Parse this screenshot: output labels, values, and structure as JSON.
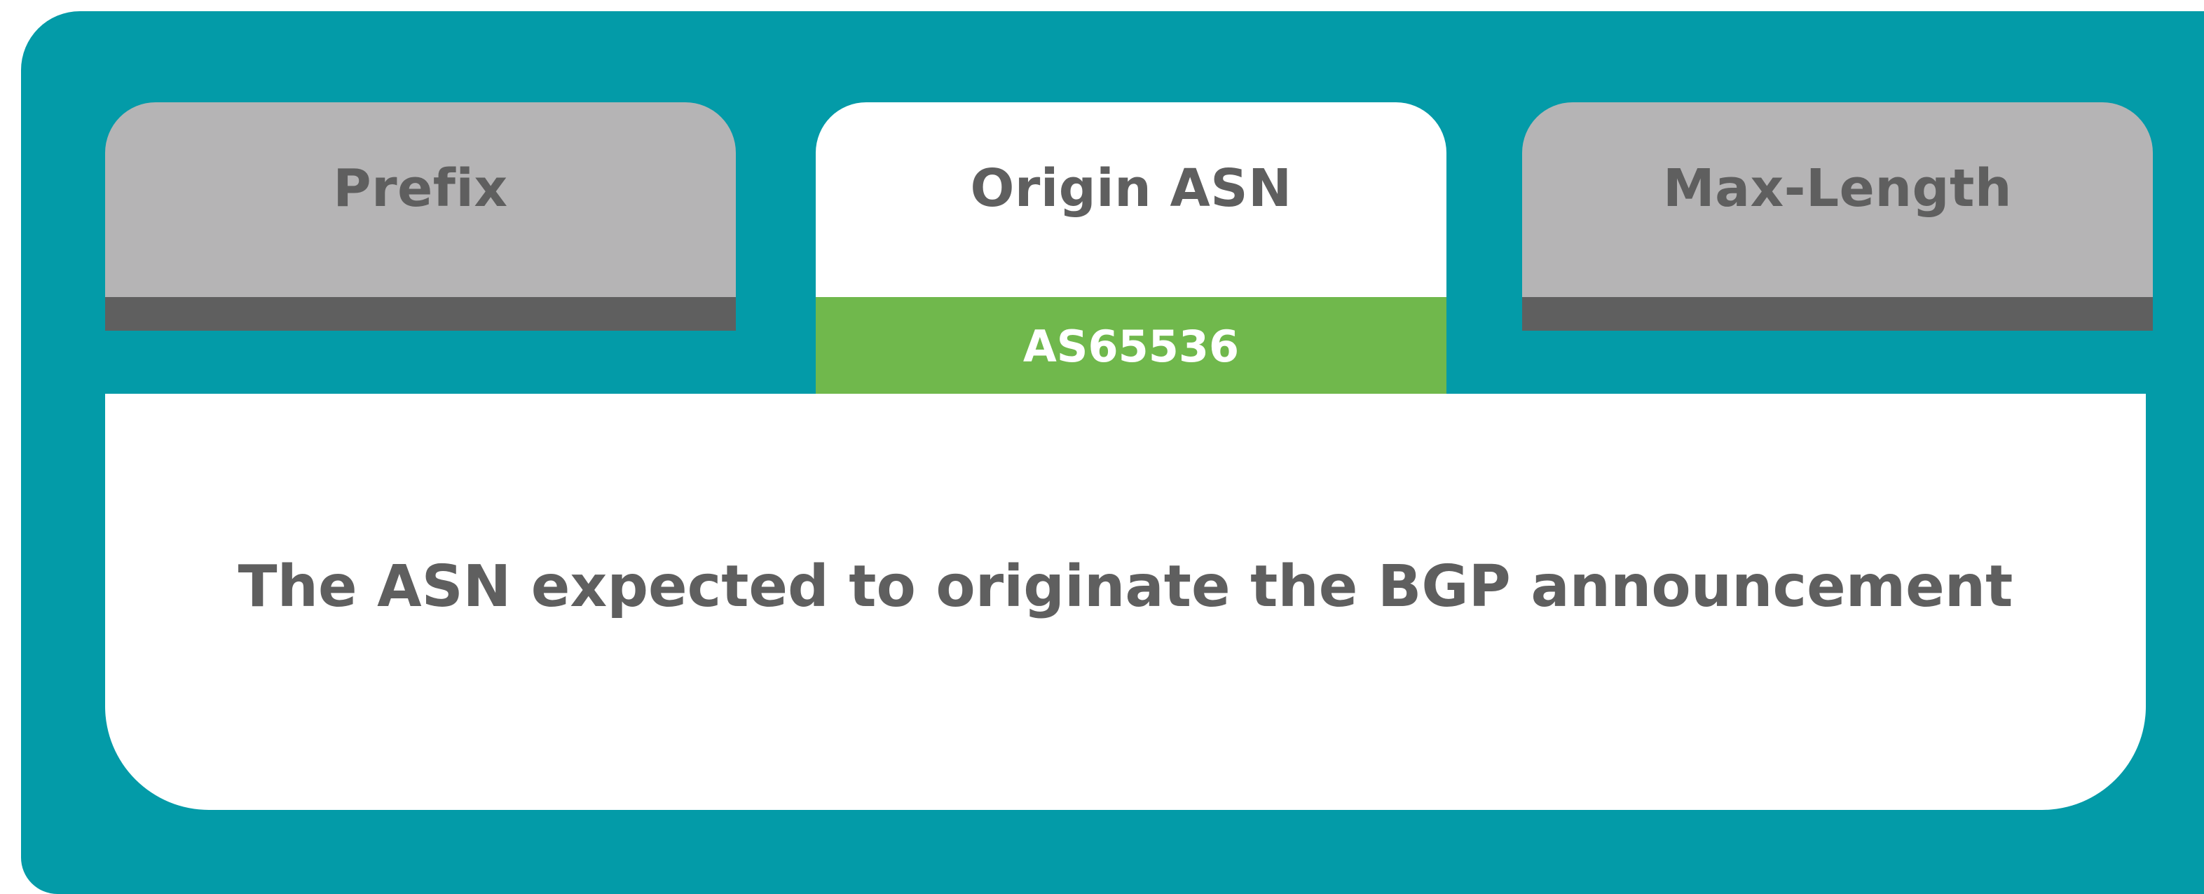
{
  "tabs": [
    {
      "label": "Prefix",
      "active": false
    },
    {
      "label": "Origin ASN",
      "active": true
    },
    {
      "label": "Max-Length",
      "active": false
    }
  ],
  "value": "AS65536",
  "description": "The ASN expected to originate the BGP announcement",
  "colors": {
    "frame": "#039ba8",
    "inactive_tab": "#b5b4b5",
    "inactive_bar": "#5f5f5f",
    "active_tab": "#ffffff",
    "value_bar": "#70b84c",
    "text": "#5f5f5f"
  }
}
